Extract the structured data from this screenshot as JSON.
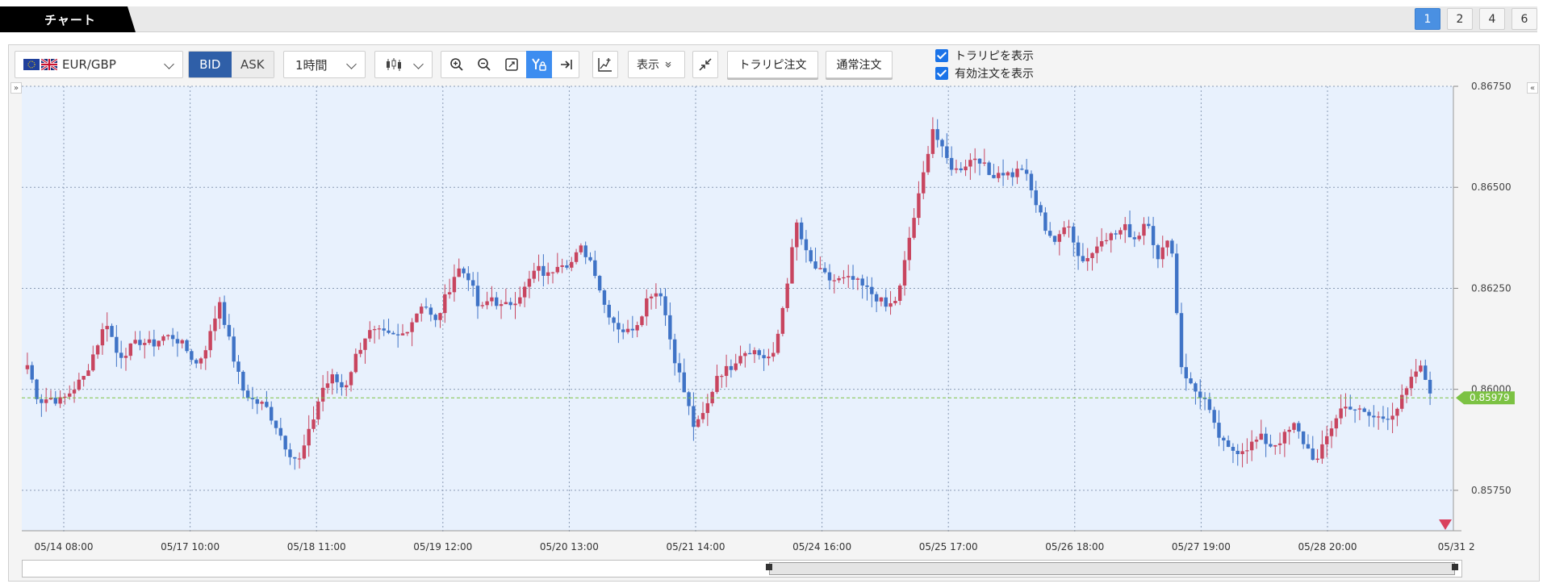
{
  "header": {
    "tab_title": "チャート",
    "layouts": [
      "1",
      "2",
      "4",
      "6"
    ],
    "active_layout": "1"
  },
  "toolbar": {
    "pair": "EUR/GBP",
    "bid_label": "BID",
    "ask_label": "ASK",
    "timeframe": "1時間",
    "display_label": "表示",
    "trarepi_order_label": "トラリピ注文",
    "normal_order_label": "通常注文",
    "show_trarepi_label": "トラリピを表示",
    "show_orders_label": "有効注文を表示"
  },
  "colors": {
    "up": "#c8455f",
    "down": "#3f73c6",
    "plot_bg": "#e8f1fd",
    "price_tag": "#7cc243",
    "active_blue": "#4a90e2"
  },
  "chart_data": {
    "type": "candlestick",
    "ylim": [
      0.8565,
      0.8675
    ],
    "y_ticks": [
      "0.86750",
      "0.86500",
      "0.86250",
      "0.86000",
      "0.85750"
    ],
    "x_labels": [
      "05/14 08:00",
      "05/17 10:00",
      "05/18 11:00",
      "05/19 12:00",
      "05/20 13:00",
      "05/21 14:00",
      "05/24 16:00",
      "05/25 17:00",
      "05/26 18:00",
      "05/27 19:00",
      "05/28 20:00",
      "05/31 2"
    ],
    "current_price": "0.85979",
    "current_value": 0.85979,
    "close_path": [
      0.8606,
      0.8597,
      0.8598,
      0.8597,
      0.86,
      0.8603,
      0.861,
      0.8617,
      0.8608,
      0.861,
      0.8612,
      0.8611,
      0.8613,
      0.8613,
      0.861,
      0.8606,
      0.8612,
      0.8622,
      0.861,
      0.86,
      0.8597,
      0.8596,
      0.8591,
      0.8585,
      0.8582,
      0.859,
      0.86,
      0.8603,
      0.86,
      0.8608,
      0.8614,
      0.8614,
      0.8613,
      0.8613,
      0.8617,
      0.8622,
      0.8616,
      0.8623,
      0.863,
      0.8628,
      0.8619,
      0.8623,
      0.862,
      0.8622,
      0.8625,
      0.863,
      0.8628,
      0.8632,
      0.8631,
      0.8635,
      0.8631,
      0.8621,
      0.8616,
      0.8614,
      0.8617,
      0.8624,
      0.8624,
      0.861,
      0.86,
      0.859,
      0.8595,
      0.8604,
      0.8605,
      0.8609,
      0.861,
      0.8608,
      0.8608,
      0.8624,
      0.8641,
      0.8632,
      0.8629,
      0.8627,
      0.8627,
      0.8627,
      0.8625,
      0.8623,
      0.862,
      0.8623,
      0.8638,
      0.865,
      0.8665,
      0.8658,
      0.8654,
      0.8656,
      0.8658,
      0.8653,
      0.8654,
      0.8653,
      0.8655,
      0.8647,
      0.864,
      0.8636,
      0.8642,
      0.8632,
      0.8633,
      0.8638,
      0.8638,
      0.864,
      0.8637,
      0.8643,
      0.8631,
      0.864,
      0.8606,
      0.86,
      0.8598,
      0.859,
      0.8585,
      0.8585,
      0.8586,
      0.8588,
      0.8586,
      0.8588,
      0.8591,
      0.8586,
      0.8582,
      0.8589,
      0.8595,
      0.8596,
      0.8594,
      0.8593,
      0.8593,
      0.8595,
      0.86,
      0.8606,
      0.86
    ]
  }
}
